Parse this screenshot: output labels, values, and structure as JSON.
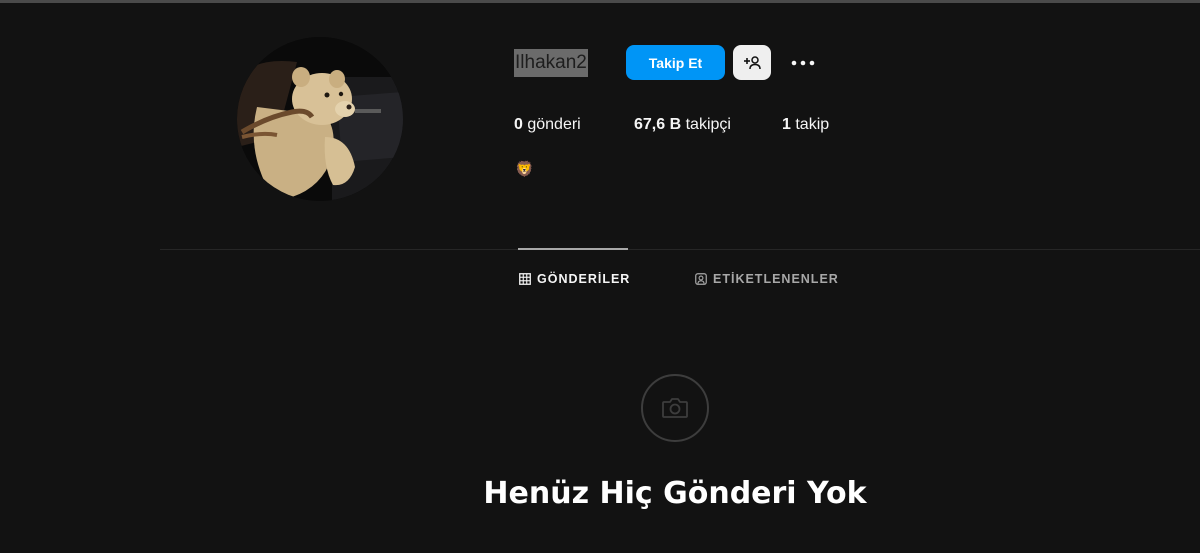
{
  "profile": {
    "username": "Ilhakan2",
    "follow_label": "Takip Et",
    "bio": "🦁"
  },
  "stats": {
    "posts_value": "0",
    "posts_label": "gönderi",
    "followers_value": "67,6 B",
    "followers_label": "takipçi",
    "following_value": "1",
    "following_label": "takip"
  },
  "tabs": [
    {
      "label": "GÖNDERİLER",
      "icon": "grid-icon",
      "active": true
    },
    {
      "label": "ETİKETLENENLER",
      "icon": "tagged-user-icon",
      "active": false
    }
  ],
  "empty_state": {
    "icon": "camera-icon",
    "title": "Henüz Hiç Gönderi Yok"
  },
  "colors": {
    "background": "#121212",
    "accent": "#0095f6",
    "text": "#f5f5f5",
    "muted": "#a8a8a8"
  }
}
